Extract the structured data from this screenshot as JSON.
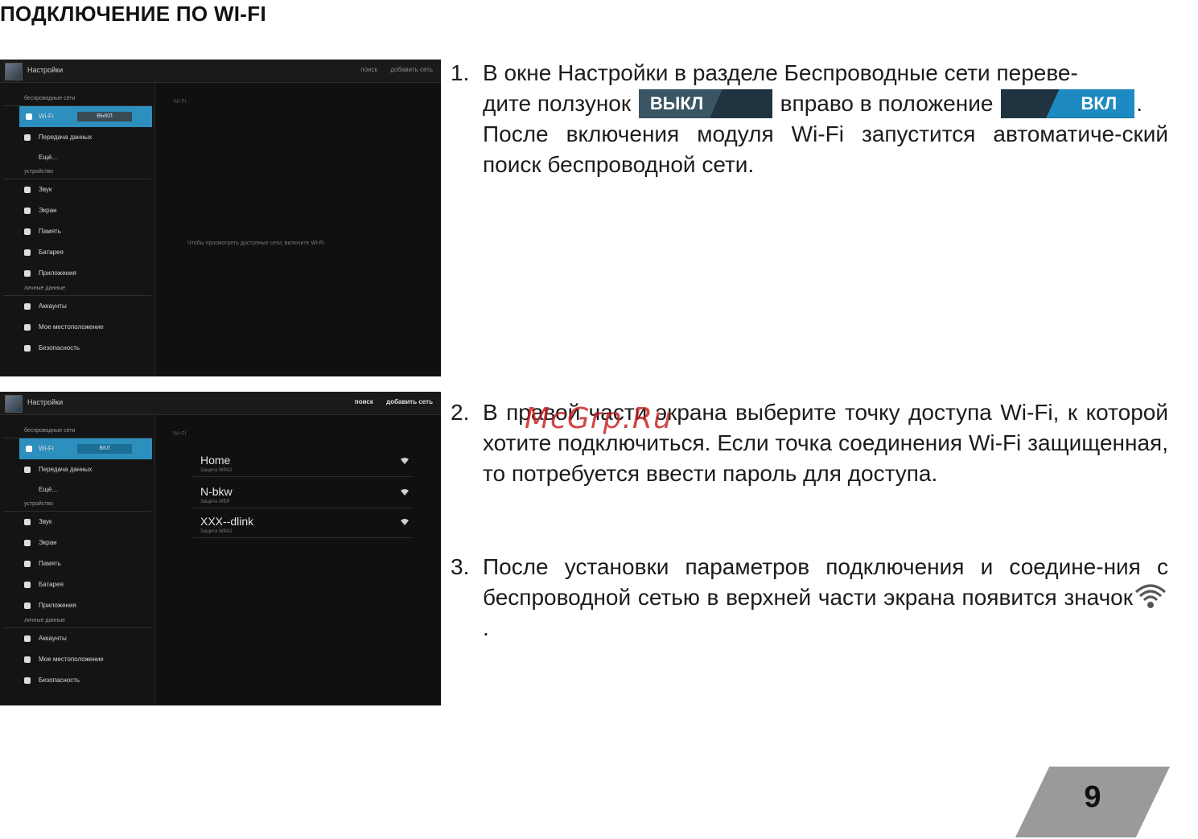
{
  "title": "ПОДКЛЮЧЕНИЕ ПО WI-FI",
  "watermark": "McGrp.Ru",
  "page_number": "9",
  "screenshot1": {
    "app_title": "Настройки",
    "actions": [
      "поиск",
      "добавить сеть"
    ],
    "pane_header": "Wi-Fi",
    "pane_hint": "Чтобы просмотреть доступные сети, включите Wi-Fi",
    "sections": {
      "wireless": "беспроводные сети",
      "device": "устройство",
      "personal": "личные данные"
    },
    "items": {
      "wifi": "Wi-Fi",
      "wifi_state": "ВЫКЛ",
      "data": "Передача данных",
      "more": "Ещё...",
      "sound": "Звук",
      "screen": "Экран",
      "memory": "Память",
      "battery": "Батарея",
      "apps": "Приложения",
      "accounts": "Аккаунты",
      "location": "Мое местоположение",
      "security": "Безопасность"
    }
  },
  "screenshot2": {
    "app_title": "Настройки",
    "actions": [
      "поиск",
      "добавить сеть"
    ],
    "pane_header": "Wi-Fi",
    "wifi_state": "ВКЛ",
    "networks": [
      {
        "name": "Home",
        "sub": "Защита WPA2"
      },
      {
        "name": "N-bkw",
        "sub": "Защита WEP"
      },
      {
        "name": "XXX--dlink",
        "sub": "Защита WPA2"
      }
    ]
  },
  "steps": {
    "s1_num": "1.",
    "s1_a": "В окне Настройки в разделе Беспроводные сети переве-",
    "s1_b": "дите ползунок",
    "s1_off": "ВЫКЛ",
    "s1_c": "вправо в положение",
    "s1_on": "ВКЛ",
    "s1_d": ".",
    "s1_e": "После включения модуля Wi-Fi запустится автоматиче-ский поиск беспроводной сети.",
    "s2_num": "2.",
    "s2_text": "В правой части экрана выберите точку доступа Wi-Fi, к которой хотите подключиться. Если точка соединения Wi-Fi защищенная, то потребуется ввести пароль для доступа.",
    "s3_num": "3.",
    "s3_text": "После установки параметров подключения и соедине-ния с беспроводной сетью в верхней части экрана появится значок",
    "s3_end": "."
  }
}
